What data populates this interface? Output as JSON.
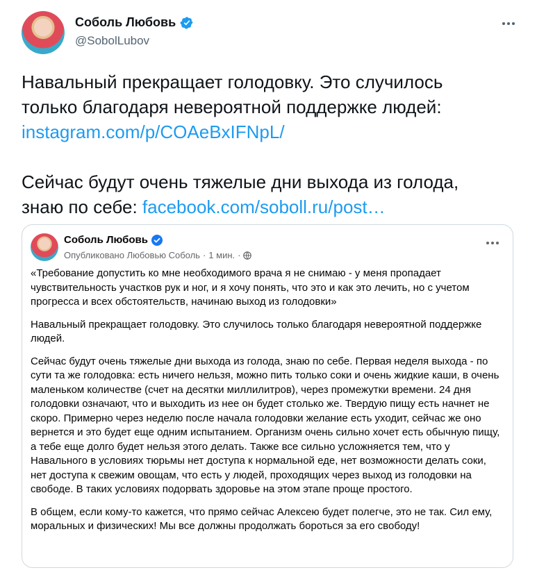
{
  "tweet": {
    "author_name": "Соболь Любовь",
    "author_handle": "@SobolLubov",
    "text_line1": "Навальный прекращает голодовку. Это случилось",
    "text_line2": "только благодаря невероятной поддержке людей:",
    "link1": "instagram.com/p/COAeBxIFNpL/",
    "text_line4": "Сейчас будут очень тяжелые дни выхода из голода,",
    "text_line5_prefix": "знаю по себе: ",
    "link2": "facebook.com/soboll.ru/post…"
  },
  "card": {
    "author_name": "Соболь Любовь",
    "meta_published": "Опубликовано Любовью Соболь",
    "meta_sep": "·",
    "meta_time": "1 мин.",
    "meta_sep2": "·",
    "paragraphs": [
      "«Требование допустить ко мне необходимого врача я не снимаю - у меня пропадает чувствительность участков рук и ног, и я хочу понять, что это и как это лечить, но с учетом прогресса и всех обстоятельств, начинаю выход из голодовки»",
      "Навальный прекращает голодовку. Это случилось только благодаря невероятной поддержке людей.",
      "Сейчас будут очень тяжелые дни выхода из голода, знаю по себе. Первая неделя выхода - по сути та же голодовка: есть ничего нельзя, можно пить только соки и очень жидкие каши, в очень маленьком количестве (счет на десятки миллилитров), через промежутки времени. 24 дня голодовки означают, что и выходить из нее он будет столько же. Твердую пищу есть начнет не скоро. Примерно через неделю после начала голодовки желание есть уходит, сейчас же оно вернется и это будет еще одним испытанием. Организм очень сильно хочет есть обычную пищу, а тебе еще долго будет нельзя этого делать. Также все сильно усложняется тем, что у Навального в условиях тюрьмы нет доступа к нормальной еде, нет возможности делать соки, нет доступа к свежим овощам, что есть у людей, проходящих через выход из голодовки на свободе. В таких условиях подорвать здоровье на этом этапе проще простого.",
      "В общем, если кому-то кажется, что прямо сейчас Алексею будет полегче, это не так. Сил ему, моральных и физических! Мы все должны продолжать бороться за его свободу!"
    ]
  },
  "colors": {
    "link": "#1d9bf0",
    "verified": "#1d9bf0",
    "fb_verified": "#1877f2"
  },
  "icons": [
    "verified-badge-icon",
    "more-icon",
    "globe-icon"
  ]
}
